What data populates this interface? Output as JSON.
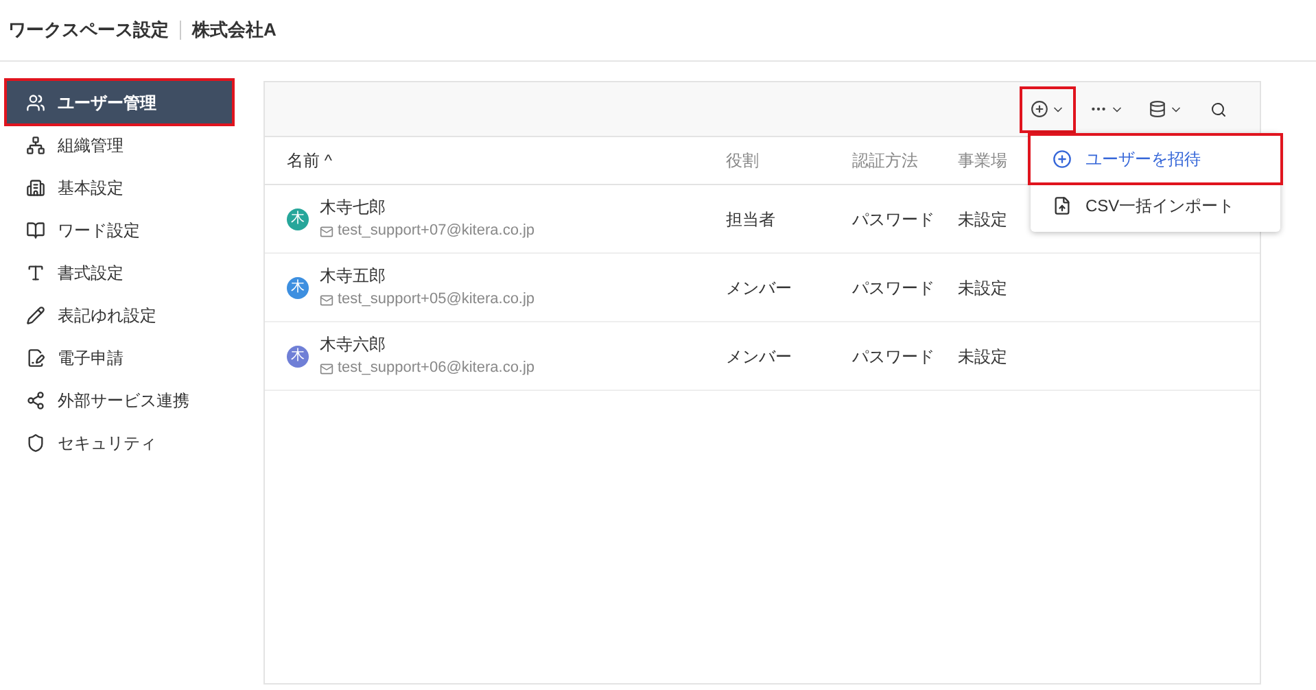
{
  "header": {
    "title": "ワークスペース設定",
    "organization": "株式会社A"
  },
  "sidebar": {
    "items": [
      {
        "label": "ユーザー管理",
        "selected": true,
        "highlighted": true
      },
      {
        "label": "組織管理",
        "selected": false,
        "highlighted": false
      },
      {
        "label": "基本設定",
        "selected": false,
        "highlighted": false
      },
      {
        "label": "ワード設定",
        "selected": false,
        "highlighted": false
      },
      {
        "label": "書式設定",
        "selected": false,
        "highlighted": false
      },
      {
        "label": "表記ゆれ設定",
        "selected": false,
        "highlighted": false
      },
      {
        "label": "電子申請",
        "selected": false,
        "highlighted": false
      },
      {
        "label": "外部サービス連携",
        "selected": false,
        "highlighted": false
      },
      {
        "label": "セキュリティ",
        "selected": false,
        "highlighted": false
      }
    ]
  },
  "toolbar": {
    "buttons": [
      {
        "highlighted": true
      },
      {
        "highlighted": false
      },
      {
        "highlighted": false
      }
    ]
  },
  "table": {
    "columns": [
      "名前 ^",
      "役割",
      "認証方法",
      "事業場"
    ],
    "rows": [
      {
        "avatar": "木",
        "color": "#26a69a",
        "name": "木寺七郎",
        "email": "test_support+07@kitera.co.jp",
        "role": "担当者",
        "auth": "パスワード",
        "office": "未設定"
      },
      {
        "avatar": "木",
        "color": "#3d8fe0",
        "name": "木寺五郎",
        "email": "test_support+05@kitera.co.jp",
        "role": "メンバー",
        "auth": "パスワード",
        "office": "未設定"
      },
      {
        "avatar": "木",
        "color": "#6f7fd6",
        "name": "木寺六郎",
        "email": "test_support+06@kitera.co.jp",
        "role": "メンバー",
        "auth": "パスワード",
        "office": "未設定"
      }
    ]
  },
  "menu": {
    "items": [
      {
        "label": "ユーザーを招待",
        "highlighted": true
      },
      {
        "label": "CSV一括インポート",
        "highlighted": false
      }
    ]
  }
}
